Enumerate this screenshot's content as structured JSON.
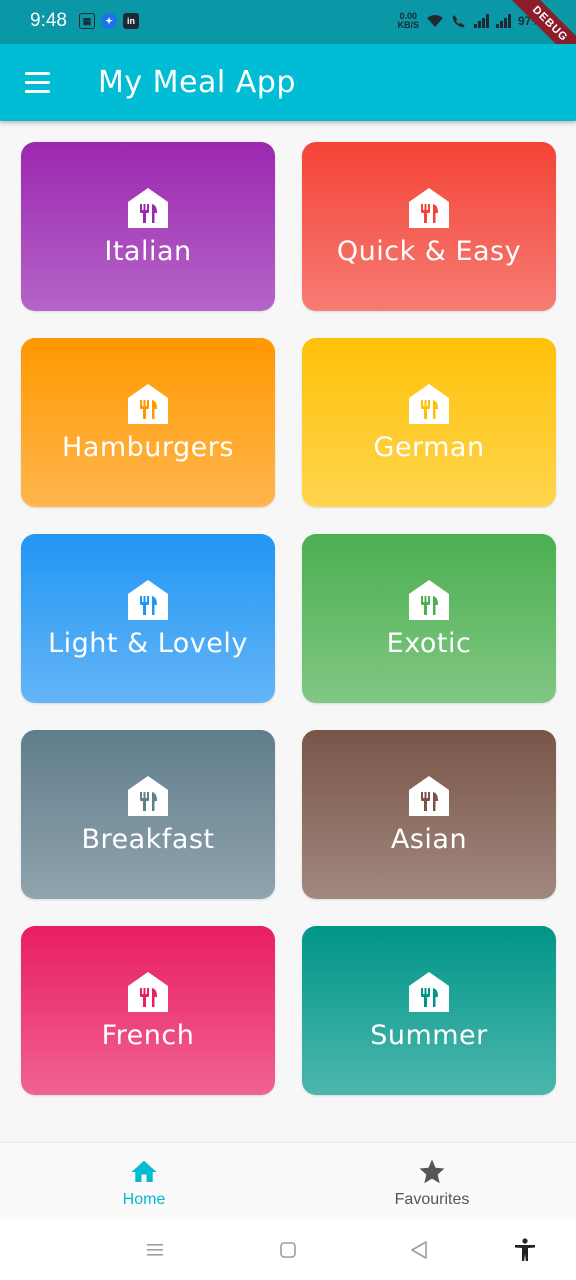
{
  "status_bar": {
    "time": "9:48",
    "net_speed_value": "0.00",
    "net_speed_unit": "KB/S",
    "battery": "97%",
    "debug_label": "DEBUG",
    "left_icons": [
      "sim-icon",
      "message-icon",
      "linkedin-icon"
    ]
  },
  "app_bar": {
    "menu_icon": "menu-icon",
    "title": "My Meal App",
    "color": "#00bcd4"
  },
  "categories": [
    {
      "title": "Italian",
      "icon": "restaurant-icon",
      "color_top": "#9c27b0",
      "color_bottom": "#b565c8",
      "icon_color": "#9c27b0"
    },
    {
      "title": "Quick & Easy",
      "icon": "restaurant-icon",
      "color_top": "#f44336",
      "color_bottom": "#f67c74",
      "icon_color": "#f44336"
    },
    {
      "title": "Hamburgers",
      "icon": "restaurant-icon",
      "color_top": "#ff9800",
      "color_bottom": "#ffb64d",
      "icon_color": "#ff9800"
    },
    {
      "title": "German",
      "icon": "restaurant-icon",
      "color_top": "#ffc107",
      "color_bottom": "#ffd54f",
      "icon_color": "#ffc107"
    },
    {
      "title": "Light & Lovely",
      "icon": "restaurant-icon",
      "color_top": "#2196f3",
      "color_bottom": "#64b5f6",
      "icon_color": "#2196f3"
    },
    {
      "title": "Exotic",
      "icon": "restaurant-icon",
      "color_top": "#4caf50",
      "color_bottom": "#81c784",
      "icon_color": "#4caf50"
    },
    {
      "title": "Breakfast",
      "icon": "restaurant-icon",
      "color_top": "#607d8b",
      "color_bottom": "#90a4ae",
      "icon_color": "#607d8b"
    },
    {
      "title": "Asian",
      "icon": "restaurant-icon",
      "color_top": "#795548",
      "color_bottom": "#a1887f",
      "icon_color": "#795548"
    },
    {
      "title": "French",
      "icon": "restaurant-icon",
      "color_top": "#e91e63",
      "color_bottom": "#f06292",
      "icon_color": "#e91e63"
    },
    {
      "title": "Summer",
      "icon": "restaurant-icon",
      "color_top": "#009688",
      "color_bottom": "#4db6ac",
      "icon_color": "#009688"
    }
  ],
  "bottom_nav": {
    "items": [
      {
        "label": "Home",
        "icon": "home-icon",
        "active": true
      },
      {
        "label": "Favourites",
        "icon": "star-icon",
        "active": false
      }
    ],
    "active_color": "#00bcd4",
    "inactive_color": "#555555"
  },
  "system_nav": [
    "recents-icon",
    "home-square-icon",
    "back-icon",
    "accessibility-icon"
  ]
}
